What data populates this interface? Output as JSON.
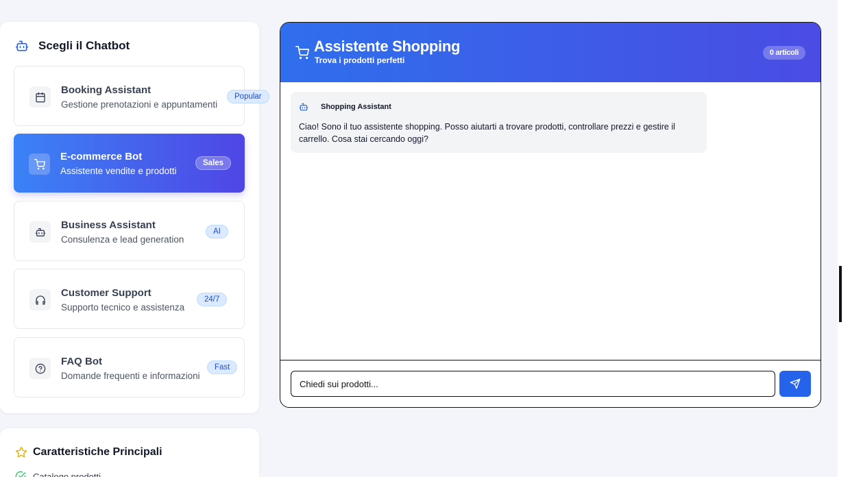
{
  "sidebar": {
    "title": "Scegli il Chatbot",
    "bots": [
      {
        "name": "Booking Assistant",
        "description": "Gestione prenotazioni e appuntamenti",
        "badge": "Popular",
        "icon": "calendar-icon",
        "active": false
      },
      {
        "name": "E-commerce Bot",
        "description": "Assistente vendite e prodotti",
        "badge": "Sales",
        "icon": "cart-icon",
        "active": true
      },
      {
        "name": "Business Assistant",
        "description": "Consulenza e lead generation",
        "badge": "AI",
        "icon": "bot-icon",
        "active": false
      },
      {
        "name": "Customer Support",
        "description": "Supporto tecnico e assistenza",
        "badge": "24/7",
        "icon": "headphones-icon",
        "active": false
      },
      {
        "name": "FAQ Bot",
        "description": "Domande frequenti e informazioni",
        "badge": "Fast",
        "icon": "help-circle-icon",
        "active": false
      }
    ]
  },
  "features": {
    "title": "Caratteristiche Principali",
    "items": [
      "Catalogo prodotti"
    ]
  },
  "chat": {
    "title": "Assistente Shopping",
    "subtitle": "Trova i prodotti perfetti",
    "cart_count": "0 articoli",
    "messages": [
      {
        "author": "Shopping Assistant",
        "text": "Ciao! Sono il tuo assistente shopping. Posso aiutarti a trovare prodotti, controllare prezzi e gestire il carrello. Cosa stai cercando oggi?"
      }
    ],
    "input_placeholder": "Chiedi sui prodotti..."
  },
  "colors": {
    "accent": "#2563eb",
    "header_gradient_start": "#2f6fed",
    "header_gradient_end": "#4a4ce3",
    "badge_bg": "#dbeafe",
    "badge_text": "#1d4ed8"
  }
}
